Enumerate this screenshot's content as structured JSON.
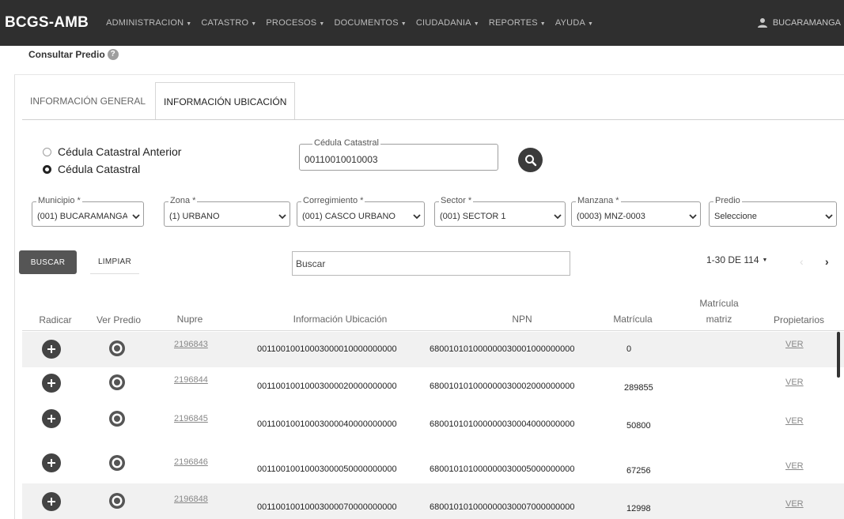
{
  "app": {
    "brand": "BCGS-AMB",
    "menu": [
      {
        "label": "ADMINISTRACION"
      },
      {
        "label": "CATASTRO"
      },
      {
        "label": "PROCESOS"
      },
      {
        "label": "DOCUMENTOS"
      },
      {
        "label": "CIUDADANIA"
      },
      {
        "label": "REPORTES"
      },
      {
        "label": "AYUDA"
      }
    ],
    "user": "BUCARAMANGA"
  },
  "page": {
    "title": "Consultar Predio",
    "help_icon": "help-circle-icon"
  },
  "tabs": [
    {
      "label": "INFORMACIÓN GENERAL",
      "active": false
    },
    {
      "label": "INFORMACIÓN UBICACIÓN",
      "active": true
    }
  ],
  "search_mode": {
    "options": [
      {
        "label": "Cédula Catastral Anterior",
        "checked": false
      },
      {
        "label": "Cédula Catastral",
        "checked": true
      }
    ]
  },
  "cedula": {
    "label": "Cédula Catastral",
    "value": "00110010010003"
  },
  "filters": {
    "municipio": {
      "label": "Municipio *",
      "value": "(001) BUCARAMANGA"
    },
    "zona": {
      "label": "Zona *",
      "value": "(1) URBANO"
    },
    "corregimiento": {
      "label": "Corregimiento *",
      "value": "(001) CASCO URBANO"
    },
    "sector": {
      "label": "Sector *",
      "value": "(001) SECTOR 1"
    },
    "manzana": {
      "label": "Manzana *",
      "value": "(0003) MNZ-0003"
    },
    "predio": {
      "label": "Predio",
      "value": "Seleccione"
    }
  },
  "actions": {
    "buscar": "BUSCAR",
    "limpiar": "LIMPIAR",
    "search_placeholder": "Buscar"
  },
  "pagination": {
    "range": "1-30 DE 114",
    "prev": "‹",
    "next": "›"
  },
  "table": {
    "headers": {
      "radicar": "Radicar",
      "ver_predio": "Ver Predio",
      "nupre": "Nupre",
      "info": "Información Ubicación",
      "npn": "NPN",
      "matricula": "Matrícula",
      "matricula_matriz_1": "Matrícula",
      "matricula_matriz_2": "matriz",
      "propietarios": "Propietarios"
    },
    "rows": [
      {
        "nupre": "2196843",
        "info": "00110010010003000010000000000",
        "npn": "680010101000000030001000000000",
        "matricula": "0",
        "propietarios": "VER"
      },
      {
        "nupre": "2196844",
        "info": "00110010010003000020000000000",
        "npn": "680010101000000030002000000000",
        "matricula": "289855",
        "propietarios": "VER"
      },
      {
        "nupre": "2196845",
        "info": "00110010010003000040000000000",
        "npn": "680010101000000030004000000000",
        "matricula": "50800",
        "propietarios": "VER"
      },
      {
        "nupre": "2196846",
        "info": "00110010010003000050000000000",
        "npn": "680010101000000030005000000000",
        "matricula": "67256",
        "propietarios": "VER"
      },
      {
        "nupre": "2196848",
        "info": "00110010010003000070000000000",
        "npn": "680010101000000030007000000000",
        "matricula": "12998",
        "propietarios": "VER"
      }
    ]
  }
}
